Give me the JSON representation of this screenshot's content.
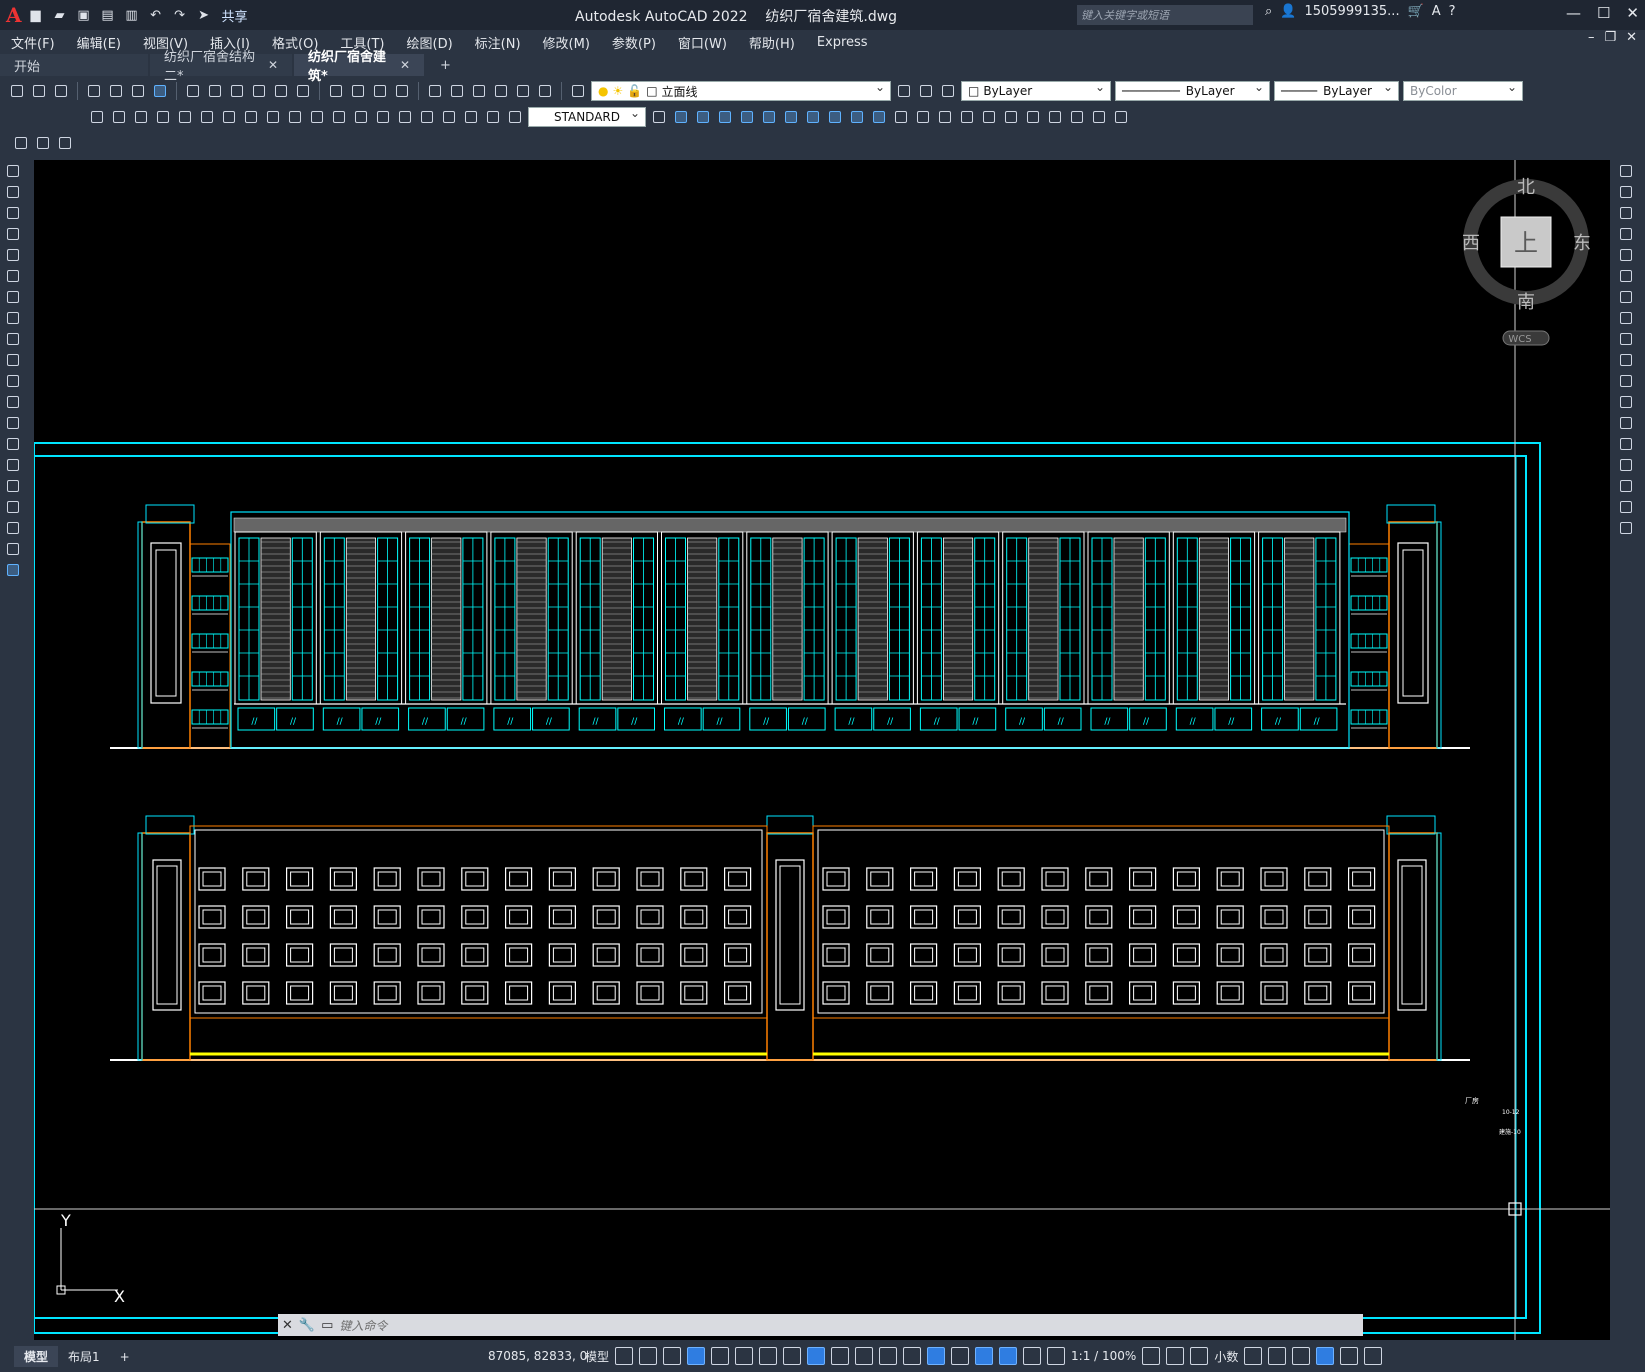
{
  "app": {
    "title": "Autodesk AutoCAD 2022",
    "file": "纺织厂宿舍建筑.dwg",
    "logo": "A"
  },
  "search": {
    "placeholder": "键入关键字或短语"
  },
  "user": {
    "name": "1505999135..."
  },
  "quick_access": {
    "share": "共享"
  },
  "menu": [
    "文件(F)",
    "编辑(E)",
    "视图(V)",
    "插入(I)",
    "格式(O)",
    "工具(T)",
    "绘图(D)",
    "标注(N)",
    "修改(M)",
    "参数(P)",
    "窗口(W)",
    "帮助(H)",
    "Express"
  ],
  "tabs": [
    {
      "label": "开始",
      "closable": false,
      "active": false
    },
    {
      "label": "纺织厂宿舍结构二*",
      "closable": true,
      "active": false
    },
    {
      "label": "纺织厂宿舍建筑*",
      "closable": true,
      "active": true
    }
  ],
  "toolbar": {
    "layer": "立面线",
    "color": "ByLayer",
    "linetype": "ByLayer",
    "lineweight": "ByLayer",
    "plotstyle": "ByColor",
    "dimstyle": "STANDARD"
  },
  "viewcube": {
    "north": "北",
    "south": "南",
    "east": "东",
    "west": "西",
    "top": "上",
    "wcs": "WCS"
  },
  "drawing": {
    "note1": "厂房",
    "note2": "10-12",
    "note3": "建施-10"
  },
  "ucs": {
    "x": "X",
    "y": "Y"
  },
  "command": {
    "placeholder": "键入命令"
  },
  "layouts": [
    {
      "label": "模型",
      "active": true
    },
    {
      "label": "布局1",
      "active": false
    }
  ],
  "status": {
    "coords": "87085, 82833, 0",
    "space": "模型",
    "scale": "1:1 / 100%",
    "units": "小数"
  },
  "colors": {
    "cyan": "#00ffff",
    "white": "#ffffff",
    "yellow": "#ffff00",
    "orange": "#ff8000",
    "red": "#ff2020",
    "bg": "#000000"
  }
}
